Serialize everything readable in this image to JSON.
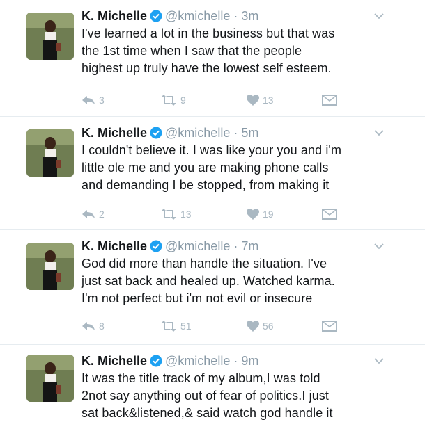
{
  "tweets": [
    {
      "name": "K. Michelle",
      "handle": "@kmichelle",
      "time": "3m",
      "lines": [
        "I've learned a lot in the business but that was",
        "the 1st time when I saw that the people",
        "highest up truly have the lowest self esteem."
      ],
      "replies": "3",
      "retweets": "9",
      "likes": "13"
    },
    {
      "name": "K. Michelle",
      "handle": "@kmichelle",
      "time": "5m",
      "lines": [
        "I couldn't believe it. I was like your you and i'm",
        "little ole me and you are making phone calls",
        "and demanding I be stopped, from making it"
      ],
      "replies": "2",
      "retweets": "13",
      "likes": "19"
    },
    {
      "name": "K. Michelle",
      "handle": "@kmichelle",
      "time": "7m",
      "lines": [
        "God did more than handle the situation. I've",
        "just sat back and healed up. Watched karma.",
        "I'm not perfect but i'm not evil or insecure"
      ],
      "replies": "8",
      "retweets": "51",
      "likes": "56"
    },
    {
      "name": "K. Michelle",
      "handle": "@kmichelle",
      "time": "9m",
      "lines": [
        "It was the title track of my album,I was told",
        "2not say anything out of fear of politics.I just",
        "sat back&listened,& said watch god handle it"
      ]
    }
  ],
  "separator": "·",
  "colors": {
    "verified": "#1da1f2",
    "muted": "#8899a6",
    "action": "#aab8c2",
    "divider": "#e6ecf0"
  },
  "icons": [
    "verified-badge-icon",
    "chevron-down-icon",
    "reply-icon",
    "retweet-icon",
    "heart-icon",
    "direct-message-icon"
  ]
}
